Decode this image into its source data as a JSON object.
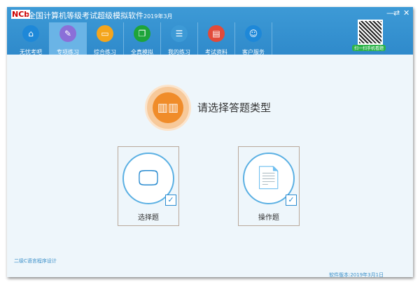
{
  "window": {
    "logo": "NCb",
    "title": "全国计算机等级考试超级模拟软件",
    "date": "2019年3月",
    "min": "—",
    "restore": "⇄",
    "close": "✕"
  },
  "nav": [
    {
      "label": "无忧考吧",
      "icon": "home-icon",
      "glyph": "⌂",
      "color": "#1e88d8"
    },
    {
      "label": "专项练习",
      "icon": "pencil-icon",
      "glyph": "✎",
      "color": "#8b6fd8"
    },
    {
      "label": "综合练习",
      "icon": "monitor-icon",
      "glyph": "▭",
      "color": "#f4a51c"
    },
    {
      "label": "全真模拟",
      "icon": "windows-icon",
      "glyph": "❐",
      "color": "#1ea43a"
    },
    {
      "label": "我的练习",
      "icon": "document-user-icon",
      "glyph": "☰",
      "color": "#3d9ad6"
    },
    {
      "label": "考试资料",
      "icon": "files-icon",
      "glyph": "▤",
      "color": "#e24a3a"
    },
    {
      "label": "客户服务",
      "icon": "headset-icon",
      "glyph": "☺",
      "color": "#1e88d8"
    }
  ],
  "qr": {
    "label": "扫一扫手机看题"
  },
  "main": {
    "prompt": "请选择答题类型",
    "prompt_glyph": "▥▥",
    "cards": [
      {
        "label": "选择题",
        "icon": "monitor-cursor-icon",
        "glyph": "🖵"
      },
      {
        "label": "操作题",
        "icon": "document-chart-icon",
        "glyph": "📄"
      }
    ],
    "check": "✓"
  },
  "footer": {
    "subject": "二级C语言程序设计",
    "version": "软件版本:2019年3月1日"
  }
}
